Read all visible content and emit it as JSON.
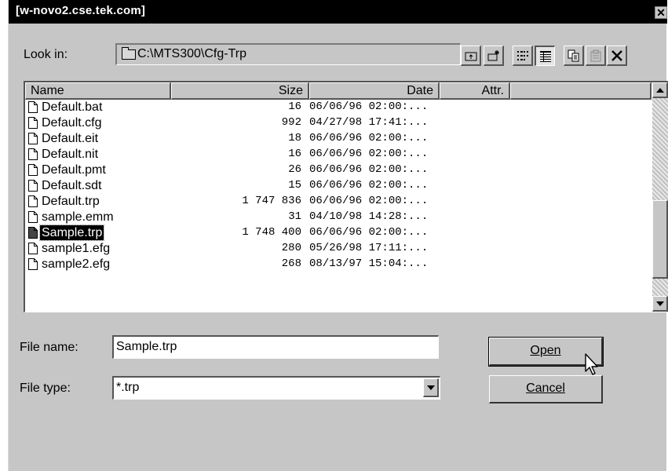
{
  "window": {
    "title": "[w-novo2.cse.tek.com]",
    "close_glyph": "✕"
  },
  "lookin": {
    "label": "Look in:",
    "value": "C:\\MTS300\\Cfg-Trp",
    "icon": "folder-icon"
  },
  "toolbar": {
    "icons": [
      "up-folder-icon",
      "new-folder-icon",
      "list-view-icon",
      "details-view-icon",
      "copy-icon",
      "paste-icon",
      "delete-icon"
    ]
  },
  "list": {
    "columns": [
      "Name",
      "Size",
      "Date",
      "Attr."
    ],
    "rows": [
      {
        "name": "Default.bat",
        "size": "16",
        "date": "06/06/96 02:00:..."
      },
      {
        "name": "Default.cfg",
        "size": "992",
        "date": "04/27/98 17:41:..."
      },
      {
        "name": "Default.eit",
        "size": "18",
        "date": "06/06/96 02:00:..."
      },
      {
        "name": "Default.nit",
        "size": "16",
        "date": "06/06/96 02:00:..."
      },
      {
        "name": "Default.pmt",
        "size": "26",
        "date": "06/06/96 02:00:..."
      },
      {
        "name": "Default.sdt",
        "size": "15",
        "date": "06/06/96 02:00:..."
      },
      {
        "name": "Default.trp",
        "size": "1 747 836",
        "date": "06/06/96 02:00:..."
      },
      {
        "name": "sample.emm",
        "size": "31",
        "date": "04/10/98 14:28:..."
      },
      {
        "name": "Sample.trp",
        "size": "1 748 400",
        "date": "06/06/96 02:00:...",
        "selected": true
      },
      {
        "name": "sample1.efg",
        "size": "280",
        "date": "05/26/98 17:11:..."
      },
      {
        "name": "sample2.efg",
        "size": "268",
        "date": "08/13/97 15:04:..."
      }
    ]
  },
  "form": {
    "file_name_label": "File name:",
    "file_name_value": "Sample.trp",
    "file_type_label": "File type:",
    "file_type_value": "*.trp"
  },
  "buttons": {
    "open_label": "Open",
    "cancel_label": "Cancel"
  }
}
